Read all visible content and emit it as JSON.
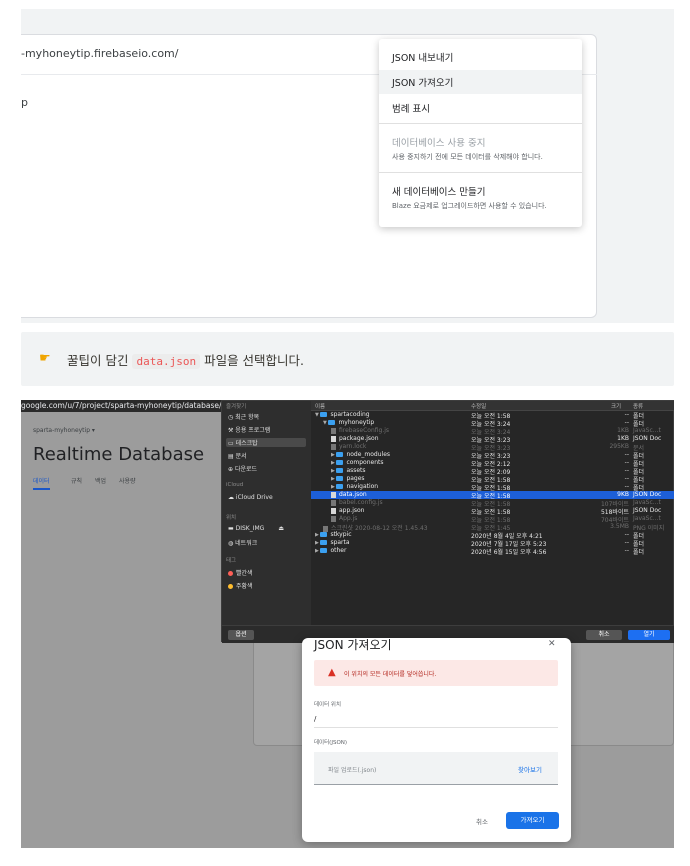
{
  "top_shot": {
    "url": "-myhoneytip.firebaseio.com/",
    "root_label": "p",
    "menu": {
      "export_json": "JSON 내보내기",
      "import_json": "JSON 가져오기",
      "show_legend": "범례 표시",
      "disable_db": "데이터베이스 사용 중지",
      "disable_db_sub": "사용 중지하기 전에 모든 데이터를 삭제해야 합니다.",
      "create_db": "새 데이터베이스 만들기",
      "create_db_sub": "Blaze 요금제로 업그레이드하면 사용할 수 있습니다."
    }
  },
  "tip": {
    "icon": "pointing-hand-icon",
    "before": "꿀팁이 담긴",
    "code": "data.json",
    "after": "파일을 선택합니다."
  },
  "bottom_shot": {
    "firebase": {
      "url": "google.com/u/7/project/sparta-myhoneytip/database/sp",
      "project": "sparta-myhoneytip ▾",
      "title": "Realtime Database",
      "tabs": [
        "데이터",
        "규칙",
        "백업",
        "사용량"
      ]
    },
    "finder": {
      "sidebar": {
        "favorites_header": "즐겨찾기",
        "recents": "최근 항목",
        "apps": "응용 프로그램",
        "desktop": "데스크탑",
        "documents": "문서",
        "downloads": "다운로드",
        "icloud_header": "iCloud",
        "icloud_drive": "iCloud Drive",
        "locations_header": "위치",
        "disk": "DISK_IMG",
        "network": "네트워크",
        "tags_header": "태그",
        "tag_red": "빨간색",
        "tag_orange": "주황색"
      },
      "columns": {
        "name": "이름",
        "date": "수정일",
        "size": "크기",
        "kind": "종류"
      },
      "rows": [
        {
          "name": "spartacoding",
          "date": "오늘 오전 1:58",
          "size": "--",
          "kind": "폴더"
        },
        {
          "name": "myhoneytip",
          "date": "오늘 오전 3:24",
          "size": "--",
          "kind": "폴더"
        },
        {
          "name": "firebaseConfig.js",
          "date": "오늘 오전 3:24",
          "size": "1KB",
          "kind": "JavaSc...t"
        },
        {
          "name": "package.json",
          "date": "오늘 오전 3:23",
          "size": "1KB",
          "kind": "JSON Doc"
        },
        {
          "name": "yarn.lock",
          "date": "오늘 오전 3:23",
          "size": "295KB",
          "kind": "문서"
        },
        {
          "name": "node_modules",
          "date": "오늘 오전 3:23",
          "size": "--",
          "kind": "폴더"
        },
        {
          "name": "components",
          "date": "오늘 오전 2:12",
          "size": "--",
          "kind": "폴더"
        },
        {
          "name": "assets",
          "date": "오늘 오전 2:09",
          "size": "--",
          "kind": "폴더"
        },
        {
          "name": "pages",
          "date": "오늘 오전 1:58",
          "size": "--",
          "kind": "폴더"
        },
        {
          "name": "navigation",
          "date": "오늘 오전 1:58",
          "size": "--",
          "kind": "폴더"
        },
        {
          "name": "data.json",
          "date": "오늘 오전 1:58",
          "size": "9KB",
          "kind": "JSON Doc"
        },
        {
          "name": "babel.config.js",
          "date": "오늘 오전 1:58",
          "size": "107바이트",
          "kind": "JavaSc...t"
        },
        {
          "name": "app.json",
          "date": "오늘 오전 1:58",
          "size": "518바이트",
          "kind": "JSON Doc"
        },
        {
          "name": "App.js",
          "date": "오늘 오전 1:58",
          "size": "704바이트",
          "kind": "JavaSc...t"
        },
        {
          "name": "스크린샷 2020-08-12 오전 1.45.43",
          "date": "오늘 오전 1:45",
          "size": "3.5MB",
          "kind": "PNG 이미지"
        },
        {
          "name": "stkypic",
          "date": "2020년 8월 4일 오후 4:21",
          "size": "--",
          "kind": "폴더"
        },
        {
          "name": "sparta",
          "date": "2020년 7월 17일 오후 5:23",
          "size": "--",
          "kind": "폴더"
        },
        {
          "name": "other",
          "date": "2020년 6월 15일 오후 4:56",
          "size": "--",
          "kind": "폴더"
        }
      ],
      "options_btn": "옵션",
      "cancel_btn": "취소",
      "open_btn": "열기"
    },
    "dialog": {
      "title": "JSON 가져오기",
      "close": "✕",
      "warning": "이 위치의 모든 데이터를 덮어씁니다.",
      "location_label": "데이터 위치",
      "location_value": "/",
      "data_label": "데이터(JSON)",
      "upload_placeholder": "파일 업로드(.json)",
      "browse": "찾아보기",
      "cancel": "취소",
      "import": "가져오기"
    }
  },
  "colors": {
    "accent_blue": "#1a73e8",
    "finder_select": "#1d5fd8",
    "code_red": "#eb5757",
    "warning_red": "#d93025"
  }
}
